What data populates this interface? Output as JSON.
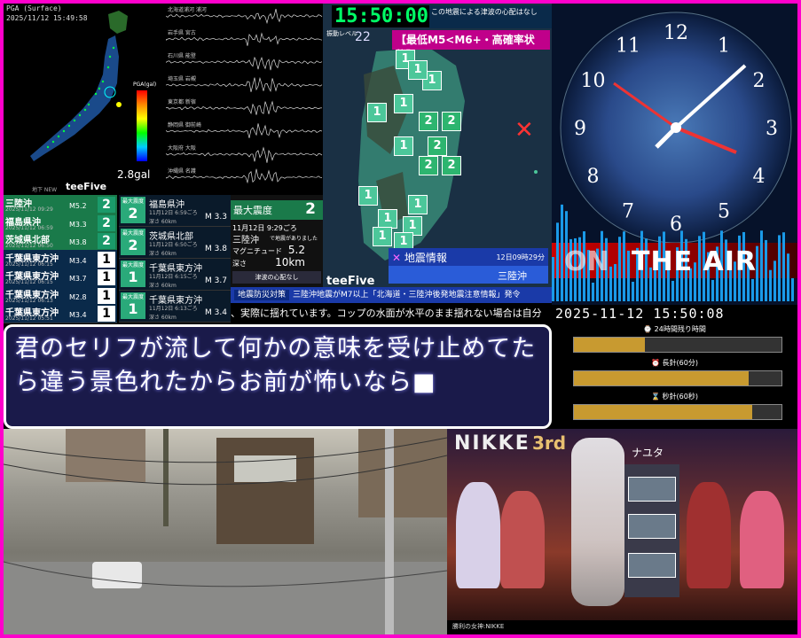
{
  "map": {
    "header": "PGA (Surface)",
    "timestamp": "2025/11/12 15:49:58",
    "gal_value": "2.8gal",
    "pga_label": "PGA(gal)",
    "brand": "teeFive",
    "brand_sub": "地下 NEW"
  },
  "seismograph": {
    "stations": [
      "北海道浦河 浦河",
      "岩手県 宮古",
      "石川県 能登",
      "埼玉県 岩槻",
      "東京都 新宿",
      "静岡県 御前崎",
      "大阪府 大阪",
      "沖縄県 名護"
    ]
  },
  "intensity_map": {
    "time": "15:50:00",
    "top_note": "この地震による津波の心配はなし",
    "level_label": "振動レベル",
    "level_value": "22",
    "warning": "【最低M5<M6+・高確率状態】",
    "brand": "teeFive",
    "eq_title": "地震情報",
    "eq_date": "12日09時29分",
    "eq_region": "三陸沖",
    "epicenter_mark": "✕",
    "boxes_1": [
      "1",
      "1",
      "1",
      "1",
      "1",
      "1",
      "1",
      "1",
      "1",
      "1",
      "1",
      "1"
    ],
    "boxes_2": [
      "2",
      "2",
      "2",
      "2",
      "2"
    ]
  },
  "clock": {
    "on_air": "THE AIR",
    "on_air_prefix": "ON",
    "numerals": [
      "12",
      "1",
      "2",
      "3",
      "4",
      "5",
      "6",
      "7",
      "8",
      "9",
      "10",
      "11"
    ]
  },
  "quake_list": [
    {
      "name": "三陸沖",
      "time": "2025/11/12 09:29",
      "mag": "M5.2",
      "scale": "2",
      "highlight": true
    },
    {
      "name": "福島県沖",
      "time": "2025/11/12 06:59",
      "mag": "M3.3",
      "scale": "2",
      "highlight": true
    },
    {
      "name": "茨城県北部",
      "time": "2025/11/12 06:50",
      "mag": "M3.8",
      "scale": "2",
      "highlight": true
    },
    {
      "name": "千葉県東方沖",
      "time": "2025/11/12 06:15",
      "mag": "M3.4",
      "scale": "1",
      "highlight": false
    },
    {
      "name": "千葉県東方沖",
      "time": "2025/11/12 06:15",
      "mag": "M3.7",
      "scale": "1",
      "highlight": false
    },
    {
      "name": "千葉県東方沖",
      "time": "2025/11/12 06:13",
      "mag": "M2.8",
      "scale": "1",
      "highlight": false
    },
    {
      "name": "千葉県東方沖",
      "time": "2025/11/12 05:51",
      "mag": "M3.4",
      "scale": "1",
      "highlight": false
    }
  ],
  "cards": [
    {
      "scale": "2",
      "scale_label": "最大震度",
      "name": "福島県沖",
      "date": "11月12日 6:59ごろ",
      "depth": "深さ 60km",
      "mag": "M 3.3"
    },
    {
      "scale": "2",
      "scale_label": "最大震度",
      "name": "茨城県北部",
      "date": "11月12日 6:50ごろ",
      "depth": "深さ 60km",
      "mag": "M 3.8"
    },
    {
      "scale": "1",
      "scale_label": "最大震度",
      "name": "千葉県東方沖",
      "date": "11月12日 6:15ごろ",
      "depth": "深さ 60km",
      "mag": "M 3.7"
    },
    {
      "scale": "1",
      "scale_label": "最大震度",
      "name": "千葉県東方沖",
      "date": "11月12日 6:13ごろ",
      "depth": "深さ 60km",
      "mag": "M 3.4"
    }
  ],
  "info": {
    "max_label": "最大震度",
    "max_value": "2",
    "date": "11月12日 9:29ごろ",
    "region": "三陸沖",
    "region_note": "で地震がありました",
    "magnitude_label": "マグニチュード",
    "magnitude": "5.2",
    "depth_label": "深さ",
    "depth": "10km",
    "tsunami": "津波の心配なし"
  },
  "infobar": {
    "tag": "地震防災対策",
    "text": "三陸沖地震がM7以上「北海道・三陸沖後発地震注意情報」発令"
  },
  "ticker": "、実際に揺れています。コップの水面が水平のまま揺れない場合は自分",
  "lyric": {
    "line1": "君のセリフが流して何かの意味を受け止めてた",
    "line2": "ら違う景色れたからお前が怖いなら■"
  },
  "timer": {
    "datetime": "2025-11-12 15:50:08",
    "bars": [
      {
        "label": "⌚ 24時間残り時間",
        "fill": 0.34
      },
      {
        "label": "⏰ 長針(60分)",
        "fill": 0.84
      },
      {
        "label": "⌛ 秒針(60秒)",
        "fill": 0.86
      }
    ]
  },
  "game": {
    "logo": "NIKKE",
    "anniv": "3rd",
    "char_name": "ナユタ",
    "footer": "勝利の女神:NIKKE"
  }
}
